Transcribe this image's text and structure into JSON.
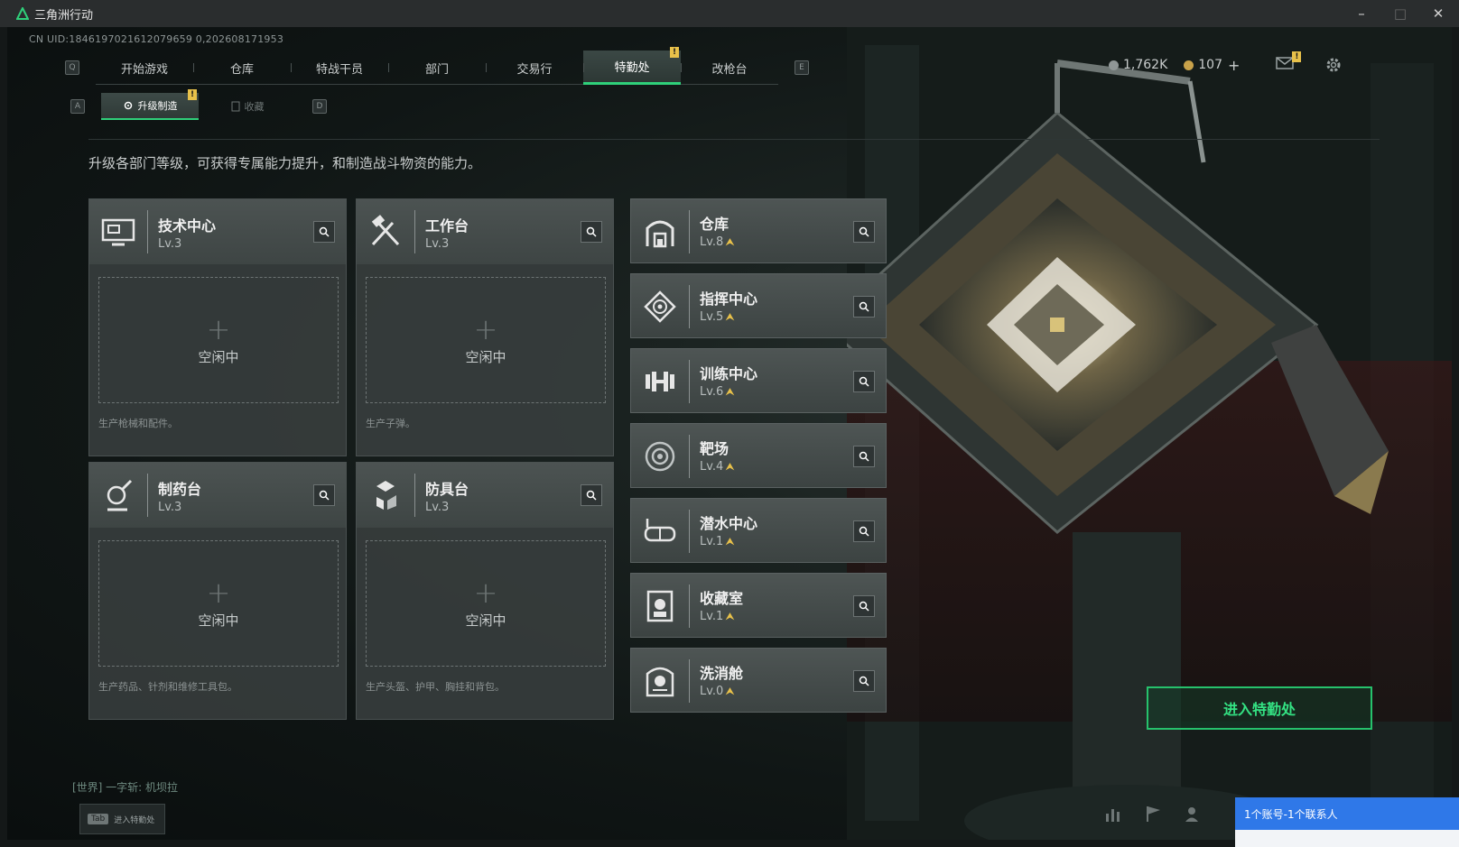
{
  "window": {
    "title": "三角洲行动",
    "controls": [
      "–",
      "□",
      "✕"
    ]
  },
  "uid": "CN UID:1846197021612079659 0,202608171953",
  "hotkeys": {
    "left_q": "Q",
    "right_e": "E",
    "left_a": "A",
    "right_d": "D"
  },
  "nav": {
    "tabs": [
      {
        "label": "开始游戏"
      },
      {
        "label": "仓库"
      },
      {
        "label": "特战干员"
      },
      {
        "label": "部门"
      },
      {
        "label": "交易行"
      },
      {
        "label": "特勤处",
        "active": true,
        "badge": "!"
      },
      {
        "label": "改枪台"
      }
    ]
  },
  "subnav": {
    "tabs": [
      {
        "label": "升级制造",
        "active": true,
        "badge": "!"
      },
      {
        "label": "收藏"
      }
    ]
  },
  "resources": {
    "currency_a": "1,762K",
    "currency_b": "107",
    "add": "+"
  },
  "description": "升级各部门等级，可获得专属能力提升，和制造战斗物资的能力。",
  "workbenches": [
    {
      "name": "技术中心",
      "level": "Lv.3",
      "idle_label": "空闲中",
      "plus": "+",
      "footer": "生产枪械和配件。",
      "icon": "monitor-icon"
    },
    {
      "name": "工作台",
      "level": "Lv.3",
      "idle_label": "空闲中",
      "plus": "+",
      "footer": "生产子弹。",
      "icon": "hammer-icon"
    },
    {
      "name": "制药台",
      "level": "Lv.3",
      "idle_label": "空闲中",
      "plus": "+",
      "footer": "生产药品、针剂和维修工具包。",
      "icon": "pharmacy-icon"
    },
    {
      "name": "防具台",
      "level": "Lv.3",
      "idle_label": "空闲中",
      "plus": "+",
      "footer": "生产头盔、护甲、胸挂和背包。",
      "icon": "armor-icon"
    }
  ],
  "departments": [
    {
      "name": "仓库",
      "level": "Lv.8",
      "icon": "warehouse-icon"
    },
    {
      "name": "指挥中心",
      "level": "Lv.5",
      "icon": "command-icon"
    },
    {
      "name": "训练中心",
      "level": "Lv.6",
      "icon": "dumbbell-icon"
    },
    {
      "name": "靶场",
      "level": "Lv.4",
      "icon": "target-icon"
    },
    {
      "name": "潜水中心",
      "level": "Lv.1",
      "icon": "diving-icon"
    },
    {
      "name": "收藏室",
      "level": "Lv.1",
      "icon": "collection-icon"
    },
    {
      "name": "洗消舱",
      "level": "Lv.0",
      "icon": "decon-icon"
    }
  ],
  "enter_button": "进入特勤处",
  "chat": "[世界] 一字斩: 机坝拉",
  "tab_hint": {
    "key": "Tab",
    "label": "进入特勤处"
  },
  "notification": "1个账号-1个联系人",
  "colors": {
    "accent": "#2fd07a",
    "badge": "#e8c14a",
    "notify": "#2f78e8"
  }
}
